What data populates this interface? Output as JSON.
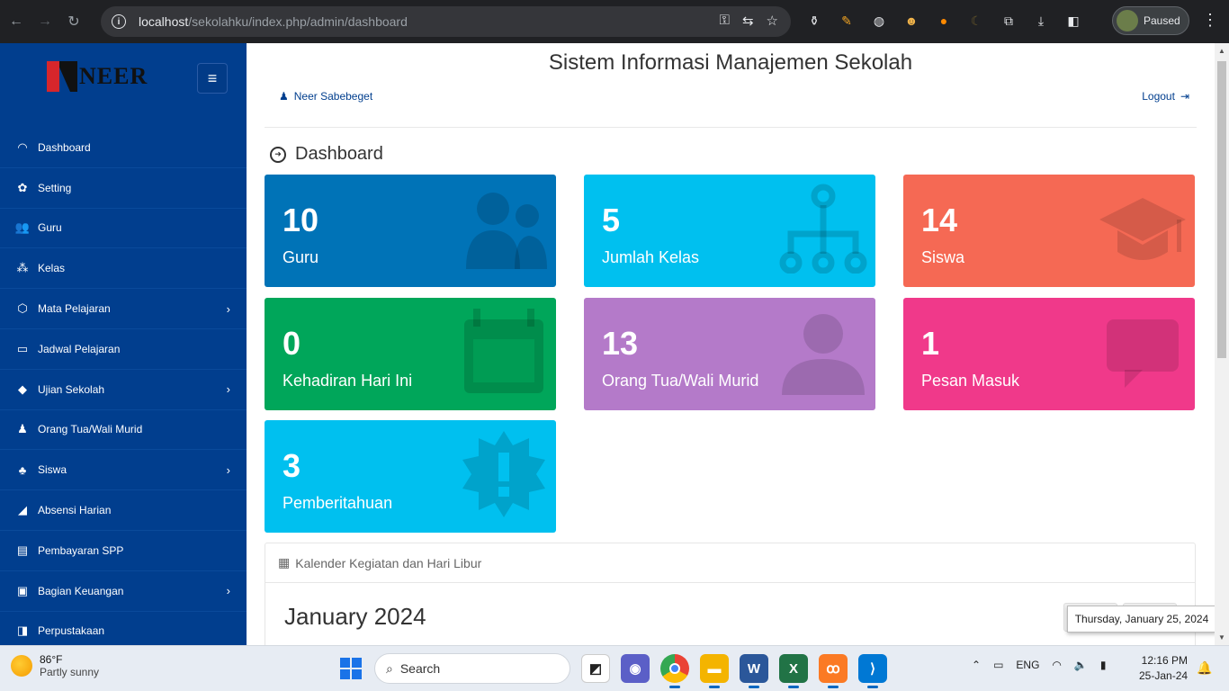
{
  "browser": {
    "url_host": "localhost",
    "url_path": "/sekolahku/index.php/admin/dashboard",
    "profile_status": "Paused"
  },
  "sidebar": {
    "brand": "NEER",
    "items": [
      {
        "label": "Dashboard",
        "icon": "gauge-icon",
        "chevron": false
      },
      {
        "label": "Setting",
        "icon": "gear-icon",
        "chevron": false
      },
      {
        "label": "Guru",
        "icon": "users-icon",
        "chevron": false
      },
      {
        "label": "Kelas",
        "icon": "sitemap-icon",
        "chevron": false
      },
      {
        "label": "Mata Pelajaran",
        "icon": "tag-icon",
        "chevron": true
      },
      {
        "label": "Jadwal Pelajaran",
        "icon": "calendar-icon",
        "chevron": false
      },
      {
        "label": "Ujian Sekolah",
        "icon": "graduation-cap-icon",
        "chevron": true
      },
      {
        "label": "Orang Tua/Wali Murid",
        "icon": "user-icon",
        "chevron": false
      },
      {
        "label": "Siswa",
        "icon": "group-icon",
        "chevron": true
      },
      {
        "label": "Absensi Harian",
        "icon": "area-chart-icon",
        "chevron": false
      },
      {
        "label": "Pembayaran SPP",
        "icon": "credit-card-icon",
        "chevron": false
      },
      {
        "label": "Bagian Keuangan",
        "icon": "briefcase-icon",
        "chevron": true
      },
      {
        "label": "Perpustakaan",
        "icon": "book-icon",
        "chevron": false
      }
    ]
  },
  "header": {
    "title": "Sistem Informasi Manajemen Sekolah",
    "user_name": "Neer Sabebeget",
    "logout": "Logout"
  },
  "page": {
    "title": "Dashboard"
  },
  "cards": [
    {
      "value": "10",
      "label": "Guru",
      "color": "#0073b7",
      "icon": "users-icon"
    },
    {
      "value": "5",
      "label": "Jumlah Kelas",
      "color": "#00c0ef",
      "icon": "sitemap-icon"
    },
    {
      "value": "14",
      "label": "Siswa",
      "color": "#f56954",
      "icon": "graduation-cap-icon"
    },
    {
      "value": "0",
      "label": "Kehadiran Hari Ini",
      "color": "#00a65a",
      "icon": "calendar-icon"
    },
    {
      "value": "13",
      "label": "Orang Tua/Wali Murid",
      "color": "#b47ac9",
      "icon": "user-icon"
    },
    {
      "value": "1",
      "label": "Pesan Masuk",
      "color": "#f0398a",
      "icon": "comment-icon"
    },
    {
      "value": "3",
      "label": "Pemberitahuan",
      "color": "#00c0ef",
      "icon": "alert-badge-icon"
    }
  ],
  "calendar": {
    "panel_title": "Kalender Kegiatan dan Hari Libur",
    "month": "January 2024",
    "tooltip": "Thursday, January 25, 2024"
  },
  "taskbar": {
    "temperature": "86°F",
    "weather": "Partly sunny",
    "search": "Search",
    "language": "ENG",
    "time": "12:16 PM",
    "date": "25-Jan-24"
  }
}
